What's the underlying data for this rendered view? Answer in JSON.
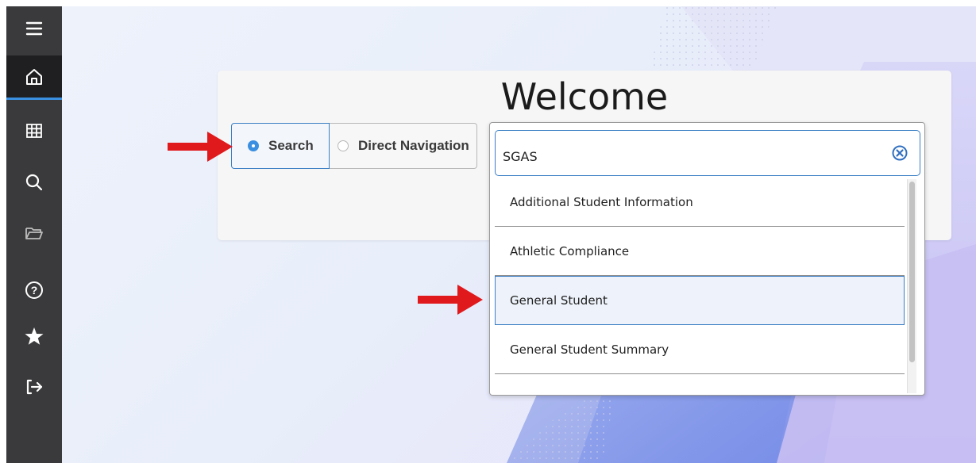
{
  "sidebar": {
    "items": [
      {
        "name": "menu-icon"
      },
      {
        "name": "home-icon"
      },
      {
        "name": "grid-icon"
      },
      {
        "name": "search-icon"
      },
      {
        "name": "folder-icon"
      },
      {
        "name": "help-icon"
      },
      {
        "name": "star-icon"
      },
      {
        "name": "sign-out-icon"
      }
    ]
  },
  "welcome": {
    "title": "Welcome"
  },
  "mode": {
    "search_label": "Search",
    "direct_label": "Direct Navigation",
    "selected": "Search"
  },
  "search": {
    "value": "SGAS"
  },
  "results": [
    "Additional Student Information",
    "Athletic Compliance",
    "General Student",
    "General Student Summary"
  ],
  "selected_result": "General Student",
  "colors": {
    "sidebar": "#3a3a3c",
    "accent": "#3b8fe0",
    "arrow": "#e0191c"
  }
}
